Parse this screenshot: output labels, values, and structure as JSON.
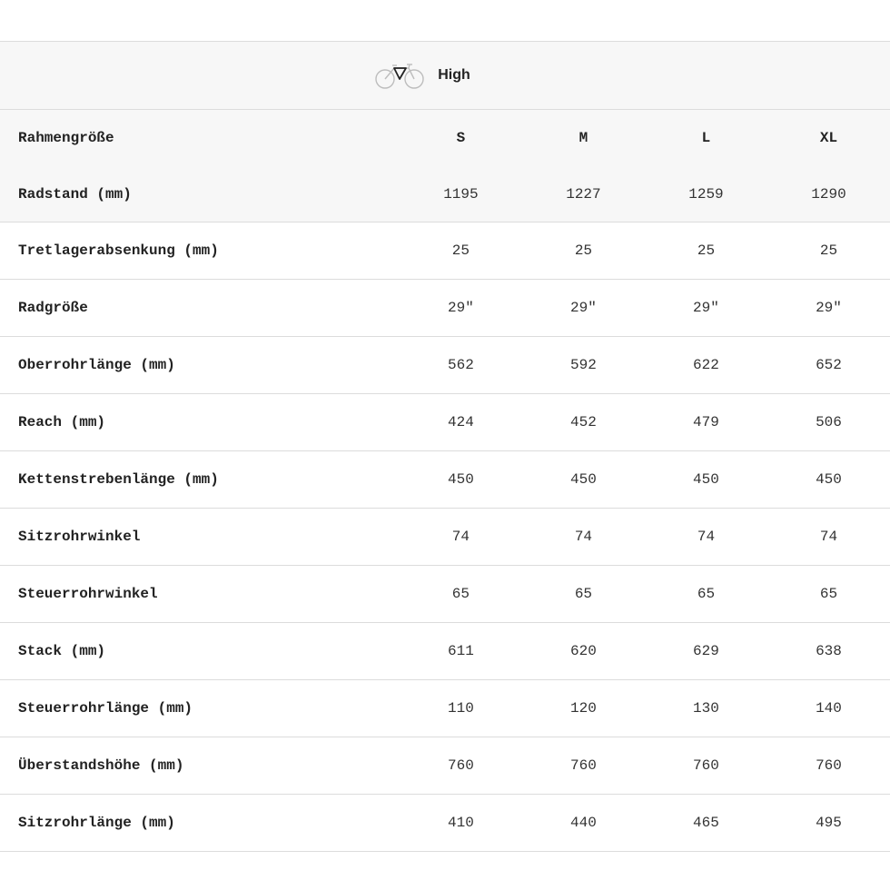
{
  "header": {
    "icon": "road-bike-icon",
    "label": "High"
  },
  "table": {
    "sizes": [
      "S",
      "M",
      "L",
      "XL"
    ],
    "size_label": "Rahmengröße",
    "rows": [
      {
        "label": "Radstand (mm)",
        "values": [
          "1195",
          "1227",
          "1259",
          "1290"
        ]
      },
      {
        "label": "Tretlagerabsenkung (mm)",
        "values": [
          "25",
          "25",
          "25",
          "25"
        ]
      },
      {
        "label": "Radgröße",
        "values": [
          "29\"",
          "29\"",
          "29\"",
          "29\""
        ]
      },
      {
        "label": "Oberrohrlänge (mm)",
        "values": [
          "562",
          "592",
          "622",
          "652"
        ]
      },
      {
        "label": "Reach (mm)",
        "values": [
          "424",
          "452",
          "479",
          "506"
        ]
      },
      {
        "label": "Kettenstrebenlänge (mm)",
        "values": [
          "450",
          "450",
          "450",
          "450"
        ]
      },
      {
        "label": "Sitzrohrwinkel",
        "values": [
          "74",
          "74",
          "74",
          "74"
        ]
      },
      {
        "label": "Steuerrohrwinkel",
        "values": [
          "65",
          "65",
          "65",
          "65"
        ]
      },
      {
        "label": "Stack (mm)",
        "values": [
          "611",
          "620",
          "629",
          "638"
        ]
      },
      {
        "label": "Steuerrohrlänge (mm)",
        "values": [
          "110",
          "120",
          "130",
          "140"
        ]
      },
      {
        "label": "Überstandshöhe (mm)",
        "values": [
          "760",
          "760",
          "760",
          "760"
        ]
      },
      {
        "label": "Sitzrohrlänge (mm)",
        "values": [
          "410",
          "440",
          "465",
          "495"
        ]
      }
    ]
  },
  "colors": {
    "header_bg": "#f7f7f7",
    "border": "#dcdcdc",
    "text": "#222222"
  }
}
